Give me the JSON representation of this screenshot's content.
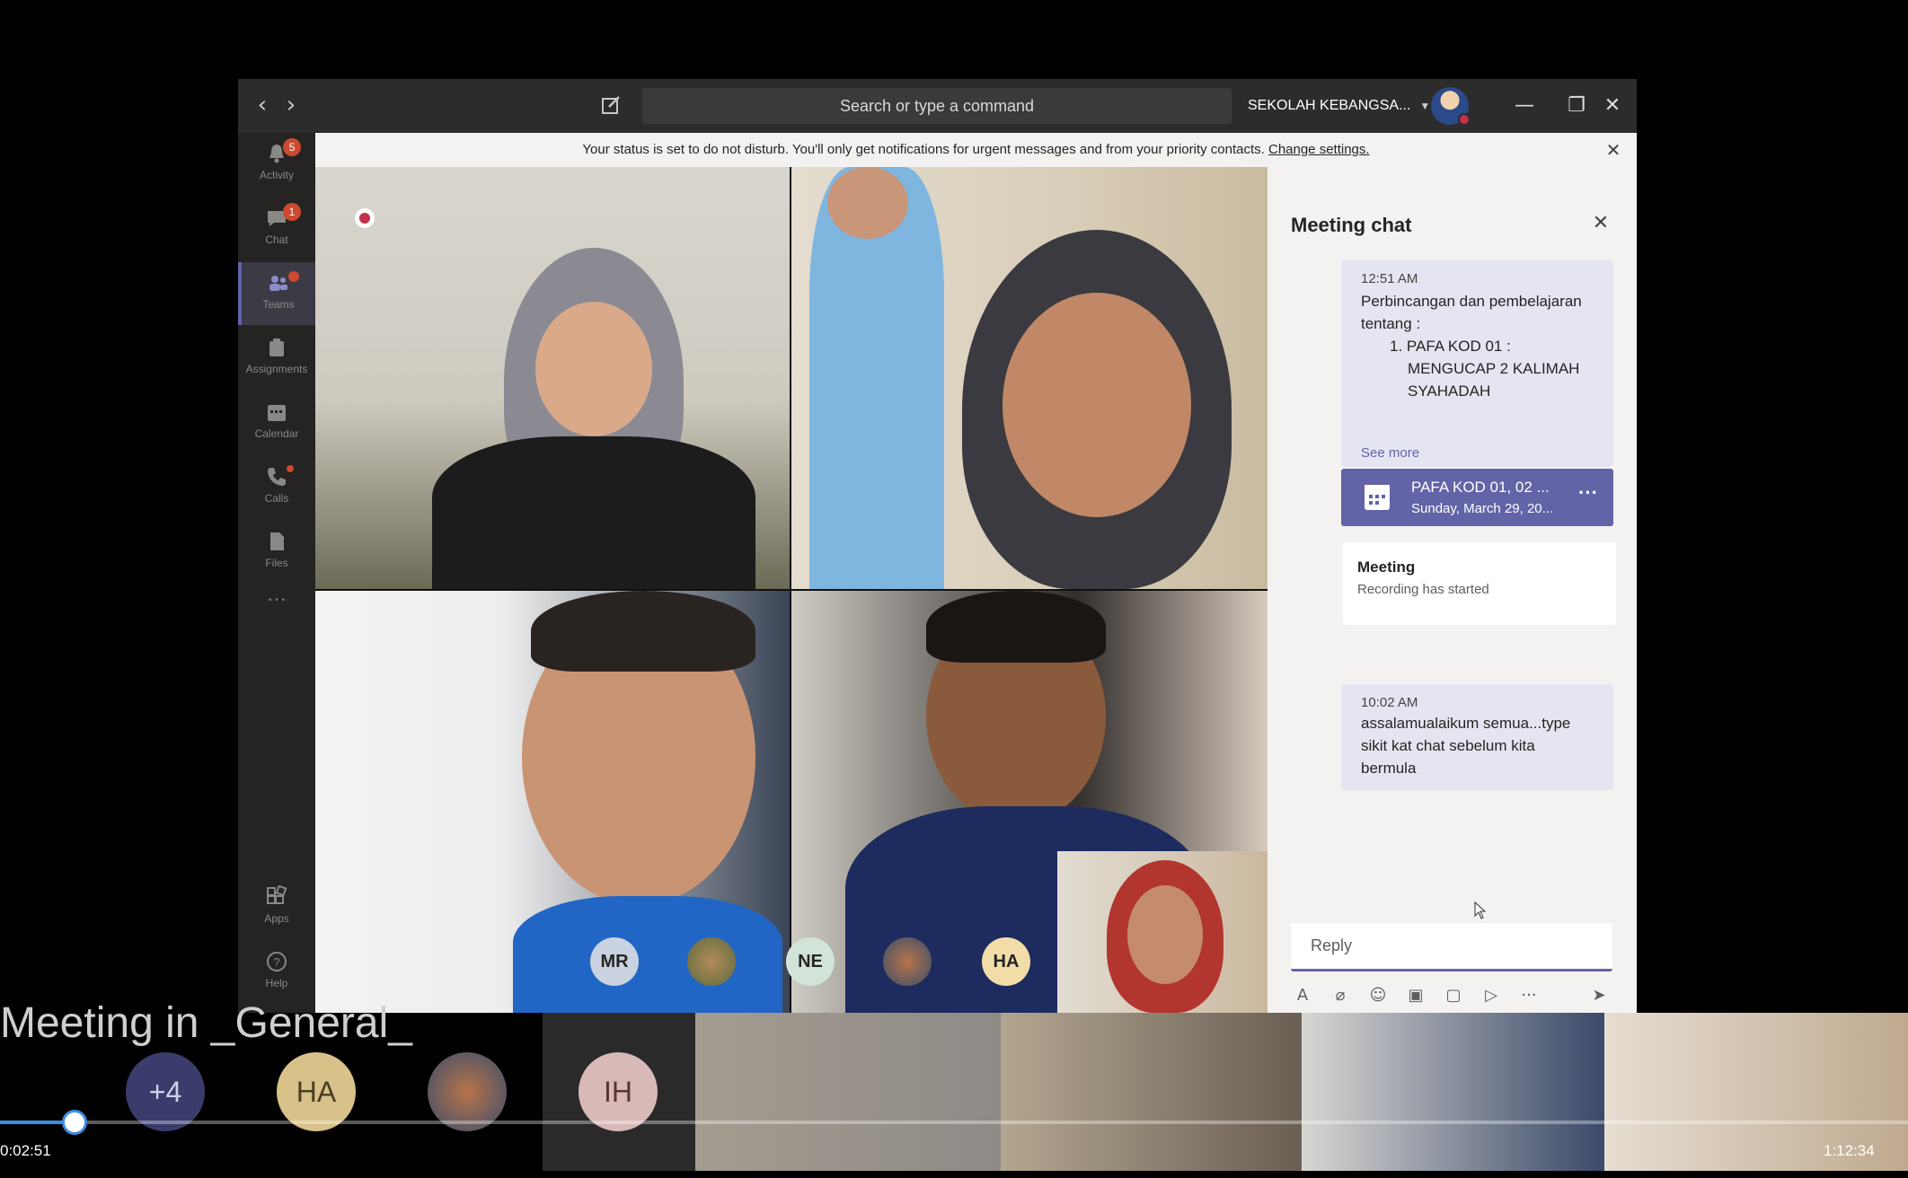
{
  "window": {
    "search_placeholder": "Search or type a command",
    "org_name": "SEKOLAH KEBANGSA..."
  },
  "rail": {
    "items": [
      {
        "label": "Activity",
        "badge": "5"
      },
      {
        "label": "Chat",
        "badge": "1"
      },
      {
        "label": "Teams",
        "badge": ""
      },
      {
        "label": "Assignments"
      },
      {
        "label": "Calendar"
      },
      {
        "label": "Calls"
      },
      {
        "label": "Files"
      },
      {
        "label": "Apps"
      },
      {
        "label": "Help"
      }
    ]
  },
  "banner": {
    "text": "Your status is set to do not disturb. You'll only get notifications for urgent messages and from your priority contacts.",
    "link": "Change settings."
  },
  "participants": {
    "overlay_avatars": [
      "MR",
      "NE",
      "HA"
    ]
  },
  "chat": {
    "title": "Meeting chat",
    "messages": [
      {
        "time": "12:51 AM",
        "lines": [
          "Perbincangan dan pembelajaran",
          "tentang :",
          "1. PAFA KOD 01 :",
          "MENGUCAP 2 KALIMAH",
          "SYAHADAH"
        ],
        "see_more": "See more"
      },
      {
        "time": "10:02 AM",
        "lines": [
          "assalamualaikum semua...type",
          "sikit kat chat sebelum kita",
          "bermula"
        ]
      }
    ],
    "event": {
      "title": "PAFA KOD 01, 02 ...",
      "date": "Sunday, March 29, 20...",
      "more": "···"
    },
    "meeting_card": {
      "title": "Meeting",
      "subtitle": "Recording has started"
    },
    "reply_placeholder": "Reply"
  },
  "player": {
    "title": "Meeting in _General_",
    "strip_avatars": [
      "+4",
      "HA",
      "IH"
    ],
    "time_elapsed": "0:02:51",
    "time_total": "1:12:34",
    "progress": 0.039
  },
  "colors": {
    "accent": "#6264a7",
    "dnd": "#c4314b",
    "badge": "#cc4a31",
    "scrubber": "#3a8ee6"
  }
}
